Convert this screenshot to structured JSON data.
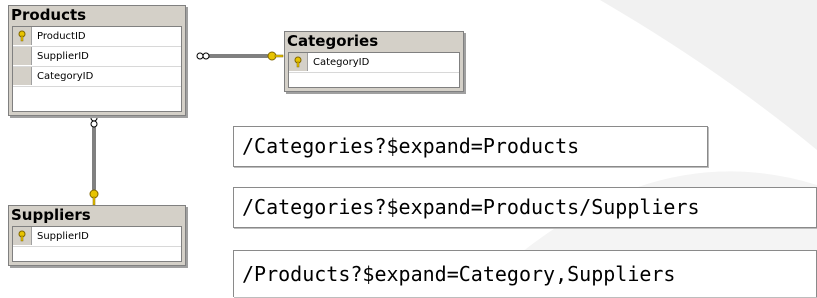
{
  "tables": {
    "products": {
      "title": "Products",
      "fields": [
        "ProductID",
        "SupplierID",
        "CategoryID"
      ],
      "key_field": "ProductID"
    },
    "categories": {
      "title": "Categories",
      "fields": [
        "CategoryID"
      ],
      "key_field": "CategoryID"
    },
    "suppliers": {
      "title": "Suppliers",
      "fields": [
        "SupplierID"
      ],
      "key_field": "SupplierID"
    }
  },
  "queries": [
    "/Categories?$expand=Products",
    "/Categories?$expand=Products/Suppliers",
    "/Products?$expand=Category,Suppliers"
  ],
  "colors": {
    "key": "#e8c400",
    "titlebar": "#d4d0c8",
    "line": "#000000"
  }
}
